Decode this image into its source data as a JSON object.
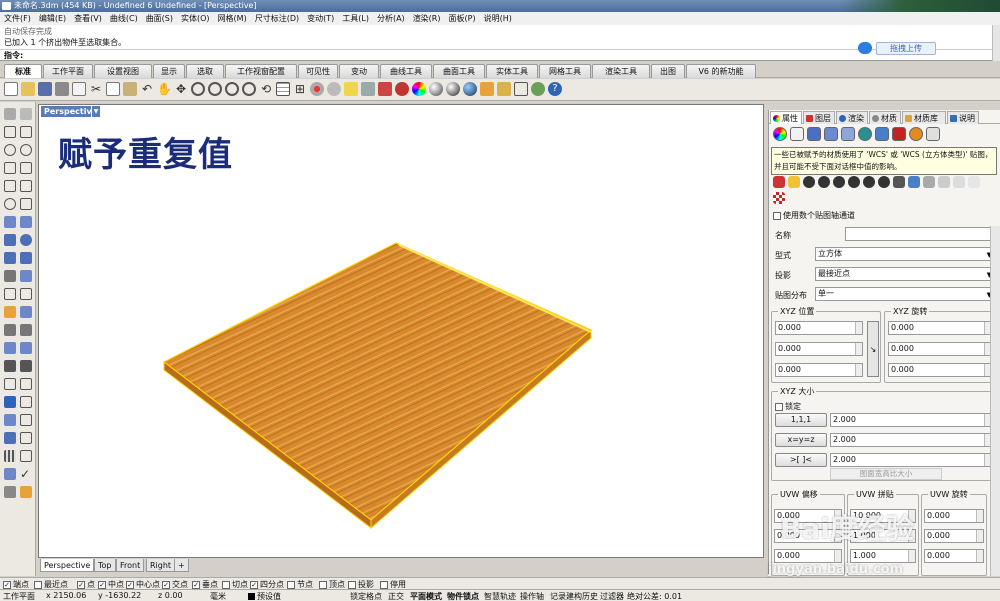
{
  "window": {
    "title": "未命名.3dm (454 KB) - Undefined 6 Undefined - [Perspective]"
  },
  "menu": [
    "文件(F)",
    "编辑(E)",
    "查看(V)",
    "曲线(C)",
    "曲面(S)",
    "实体(O)",
    "网格(M)",
    "尺寸标注(D)",
    "变动(T)",
    "工具(L)",
    "分析(A)",
    "渲染(R)",
    "面板(P)",
    "说明(H)"
  ],
  "command": {
    "history_1": "自动保存完成",
    "history_2": "已加入 1 个挤出物件至选取集合。",
    "prompt": "指令:",
    "upload_label": "拖拽上传"
  },
  "tabs": [
    "标准",
    "工作平面",
    "设置视图",
    "显示",
    "选取",
    "工作视窗配置",
    "可见性",
    "变动",
    "曲线工具",
    "曲面工具",
    "实体工具",
    "网格工具",
    "渲染工具",
    "出图",
    "V6 的新功能"
  ],
  "viewport": {
    "label": "Perspective",
    "heading": "赋予重复值"
  },
  "viewport_tabs": [
    "Perspective",
    "Top",
    "Front",
    "Right"
  ],
  "osnap": [
    {
      "label": "端点",
      "checked": true
    },
    {
      "label": "最近点",
      "checked": false
    },
    {
      "label": "点",
      "checked": true
    },
    {
      "label": "中点",
      "checked": true
    },
    {
      "label": "中心点",
      "checked": true
    },
    {
      "label": "交点",
      "checked": true
    },
    {
      "label": "垂点",
      "checked": true
    },
    {
      "label": "切点",
      "checked": false
    },
    {
      "label": "四分点",
      "checked": true
    },
    {
      "label": "节点",
      "checked": false
    },
    {
      "label": "顶点",
      "checked": false
    },
    {
      "label": "投影",
      "checked": false
    },
    {
      "label": "停用",
      "checked": false
    }
  ],
  "status": {
    "cplane": "工作平面",
    "x": "x 2150.06",
    "y": "y -1630.22",
    "z": "z 0.00",
    "unit": "毫米",
    "layer": "预设值",
    "lock_grid": "锁定格点",
    "ortho": "正交",
    "planar": "平面模式",
    "osnap": "物件锁点",
    "smarttrack": "智慧轨迹",
    "gumball": "操作轴",
    "history": "记录建构历史",
    "filter": "过滤器",
    "tolerance": "绝对公差: 0.01"
  },
  "panel": {
    "tabs": [
      "属性",
      "图层",
      "渲染",
      "材质",
      "材质库",
      "说明"
    ],
    "tooltip": "一些已被赋予的材质使用了 'WCS' 或 'WCS (立方体类型)' 贴图，并且可能不受下面对话框中值的影响。",
    "multi_channel_label": "使用数个贴图轴通道",
    "name_label": "名称",
    "name_value": "",
    "type_label": "型式",
    "type_value": "立方体",
    "projection_label": "投影",
    "projection_value": "最接近点",
    "distribution_label": "贴图分布",
    "distribution_value": "单一",
    "xyz_position_title": "XYZ 位置",
    "xyz_position": [
      "0.000",
      "0.000",
      "0.000"
    ],
    "xyz_rotation_title": "XYZ 旋转",
    "xyz_rotation": [
      "0.000",
      "0.000",
      "0.000"
    ],
    "xyz_size_title": "XYZ 大小",
    "lock_label": "锁定",
    "size_buttons": [
      "1,1,1",
      "x=y=z",
      ">[ ]<"
    ],
    "xyz_size": [
      "2.000",
      "2.000",
      "2.000"
    ],
    "image_ratio_label": "图面宽高比大小",
    "uvw_offset_title": "UVW 偏移",
    "uvw_offset": [
      "0.000",
      "0.000",
      "0.000"
    ],
    "uvw_repeat_title": "UVW 拼贴",
    "uvw_repeat": [
      "10.000",
      "1.000",
      "1.000"
    ],
    "uvw_rotation_title": "UVW 旋转",
    "uvw_rotation": [
      "0.000",
      "0.000",
      "0.000"
    ]
  },
  "watermark": {
    "main": "Bai度经验",
    "sub": "jingyan.baidu.com"
  },
  "colors": {
    "wood": "#d98a2b",
    "selection": "#ffd400",
    "heading": "#1b2c7a",
    "viewport_label": "#5a7cb6"
  }
}
